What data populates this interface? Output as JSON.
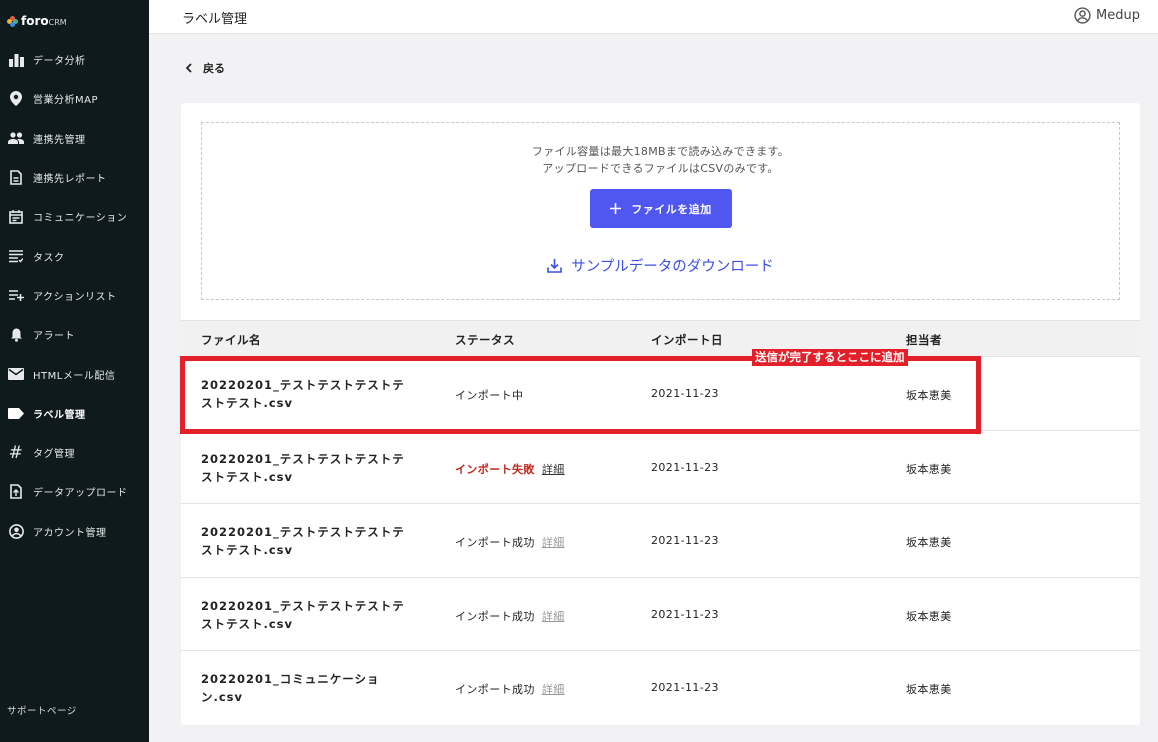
{
  "brand": {
    "name": "foro",
    "suffix": "CRM"
  },
  "sidebar": {
    "items": [
      {
        "label": "データ分析",
        "icon": "bar-chart-icon"
      },
      {
        "label": "営業分析MAP",
        "icon": "map-pin-icon"
      },
      {
        "label": "連携先管理",
        "icon": "people-icon"
      },
      {
        "label": "連携先レポート",
        "icon": "document-icon"
      },
      {
        "label": "コミュニケーション",
        "icon": "calendar-icon"
      },
      {
        "label": "タスク",
        "icon": "task-list-icon"
      },
      {
        "label": "アクションリスト",
        "icon": "playlist-add-icon"
      },
      {
        "label": "アラート",
        "icon": "bell-icon"
      },
      {
        "label": "HTMLメール配信",
        "icon": "mail-icon"
      },
      {
        "label": "ラベル管理",
        "icon": "label-icon"
      },
      {
        "label": "タグ管理",
        "icon": "hashtag-icon"
      },
      {
        "label": "データアップロード",
        "icon": "upload-file-icon"
      },
      {
        "label": "アカウント管理",
        "icon": "account-circle-icon"
      }
    ],
    "active_index": 9,
    "support": "サポートページ"
  },
  "header": {
    "title": "ラベル管理",
    "user": "Medup"
  },
  "back_label": "戻る",
  "upload": {
    "line1": "ファイル容量は最大18MBまで読み込みできます。",
    "line2": "アップロードできるファイルはCSVのみです。",
    "add_button": "ファイルを追加",
    "download_link": "サンプルデータのダウンロード"
  },
  "table": {
    "columns": [
      "ファイル名",
      "ステータス",
      "インポート日",
      "担当者"
    ],
    "rows": [
      {
        "file_line1": "20220201_テストテストテストテ",
        "file_line2": "ストテスト.csv",
        "status": "インポート中",
        "detail": "",
        "date": "2021-11-23",
        "owner": "坂本恵美"
      },
      {
        "file_line1": "20220201_テストテストテストテ",
        "file_line2": "ストテスト.csv",
        "status": "インポート失敗",
        "detail": "詳細",
        "date": "2021-11-23",
        "owner": "坂本恵美"
      },
      {
        "file_line1": "20220201_テストテストテストテ",
        "file_line2": "ストテスト.csv",
        "status": "インポート成功",
        "detail": "詳細",
        "date": "2021-11-23",
        "owner": "坂本恵美"
      },
      {
        "file_line1": "20220201_テストテストテストテ",
        "file_line2": "ストテスト.csv",
        "status": "インポート成功",
        "detail": "詳細",
        "date": "2021-11-23",
        "owner": "坂本恵美"
      },
      {
        "file_line1": "20220201_コミュニケーショ",
        "file_line2": "ン.csv",
        "status": "インポート成功",
        "detail": "詳細",
        "date": "2021-11-23",
        "owner": "坂本恵美"
      }
    ]
  },
  "annotation": {
    "label": "送信が完了するとここに追加",
    "color": "#e3202a"
  },
  "colors": {
    "sidebar_bg": "#0e1a1c",
    "primary": "#5057f0",
    "link": "#3d4fe0",
    "error": "#c0281c"
  }
}
